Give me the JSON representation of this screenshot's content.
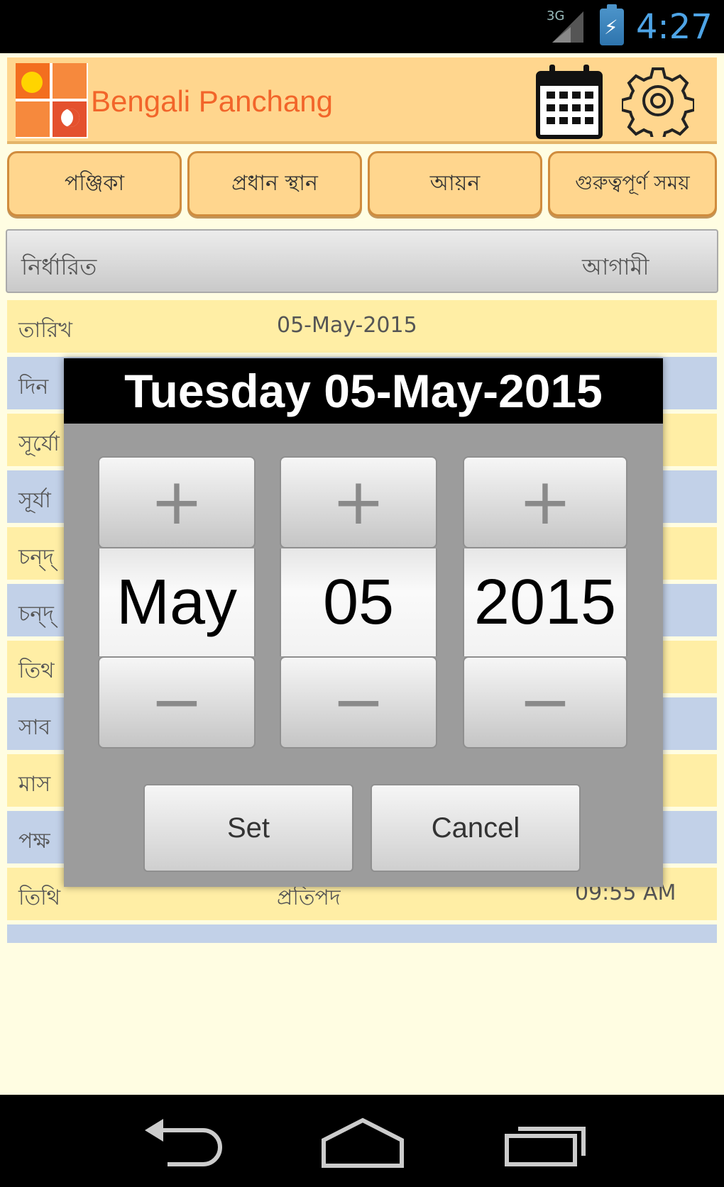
{
  "status_bar": {
    "network": "3G",
    "time": "4:27",
    "icons": [
      "signal-icon",
      "battery-charging-icon"
    ]
  },
  "app": {
    "title": "Bengali Panchang",
    "icons": [
      "app-logo",
      "calendar-icon",
      "settings-gear-icon"
    ]
  },
  "tabs": [
    "পঞ্জিকা",
    "প্রধান স্থান",
    "আয়ন",
    "গুরুত্বপূর্ণ সময়"
  ],
  "header": {
    "left": "নির্ধারিত",
    "right": "আগামী"
  },
  "rows": [
    {
      "c1": "তারিখ",
      "c2": "05-May-2015",
      "c3": ""
    },
    {
      "c1": "দিন",
      "c2": "",
      "c3": ""
    },
    {
      "c1": "সূর্যো",
      "c2": "",
      "c3": ""
    },
    {
      "c1": "সূর্যা",
      "c2": "",
      "c3": ""
    },
    {
      "c1": "চন্দ্",
      "c2": "",
      "c3": ""
    },
    {
      "c1": "চন্দ্",
      "c2": "",
      "c3": ""
    },
    {
      "c1": "তিথ",
      "c2": "",
      "c3": ""
    },
    {
      "c1": "সাব",
      "c2": "",
      "c3": ""
    },
    {
      "c1": "মাস",
      "c2": "",
      "c3": ""
    },
    {
      "c1": "পক্ষ",
      "c2": "",
      "c3": ""
    },
    {
      "c1": "তিথি",
      "c2": "প্রতিপদ",
      "c3": "09:55 AM"
    },
    {
      "c1": "",
      "c2": "",
      "c3": ""
    }
  ],
  "dialog": {
    "title": "Tuesday 05-May-2015",
    "month": "May",
    "day": "05",
    "year": "2015",
    "plus": "+",
    "minus": "−",
    "set_label": "Set",
    "cancel_label": "Cancel"
  },
  "navbar": {
    "icons": [
      "back-icon",
      "home-icon",
      "recent-apps-icon"
    ]
  },
  "colors": {
    "titlebar": "#ffd68e",
    "row_yellow": "#ffeea5",
    "row_blue": "#c2d1e8",
    "title_orange": "#f2652a",
    "clock_blue": "#4ea4e6"
  }
}
